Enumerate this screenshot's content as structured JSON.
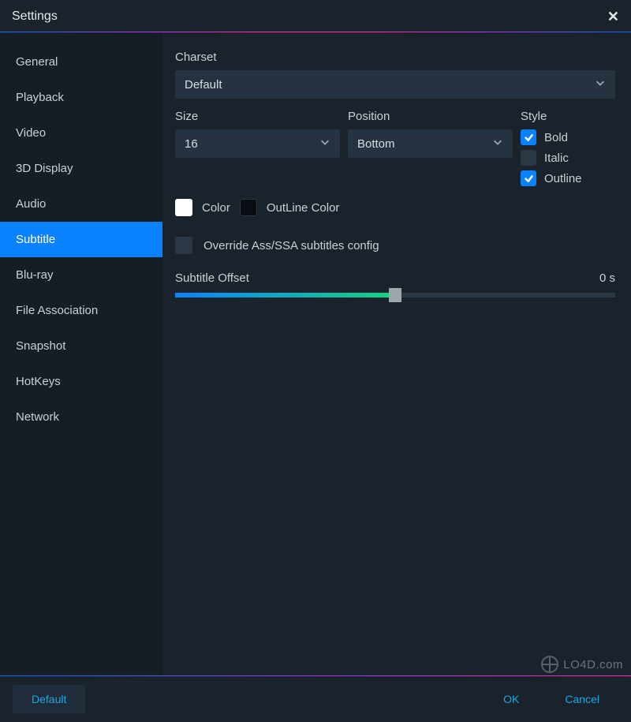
{
  "title": "Settings",
  "sidebar": {
    "items": [
      {
        "label": "General"
      },
      {
        "label": "Playback"
      },
      {
        "label": "Video"
      },
      {
        "label": "3D Display"
      },
      {
        "label": "Audio"
      },
      {
        "label": "Subtitle"
      },
      {
        "label": "Blu-ray"
      },
      {
        "label": "File Association"
      },
      {
        "label": "Snapshot"
      },
      {
        "label": "HotKeys"
      },
      {
        "label": "Network"
      }
    ],
    "active_index": 5
  },
  "main": {
    "charset_label": "Charset",
    "charset_value": "Default",
    "size_label": "Size",
    "size_value": "16",
    "position_label": "Position",
    "position_value": "Bottom",
    "style_label": "Style",
    "style_bold_label": "Bold",
    "style_bold_checked": true,
    "style_italic_label": "Italic",
    "style_italic_checked": false,
    "style_outline_label": "Outline",
    "style_outline_checked": true,
    "color_label": "Color",
    "color_value": "#ffffff",
    "outline_color_label": "OutLine Color",
    "outline_color_value": "#000000",
    "override_label": "Override Ass/SSA subtitles config",
    "override_checked": false,
    "offset_label": "Subtitle Offset",
    "offset_value": "0 s"
  },
  "footer": {
    "default_label": "Default",
    "ok_label": "OK",
    "cancel_label": "Cancel"
  },
  "watermark": "LO4D.com"
}
